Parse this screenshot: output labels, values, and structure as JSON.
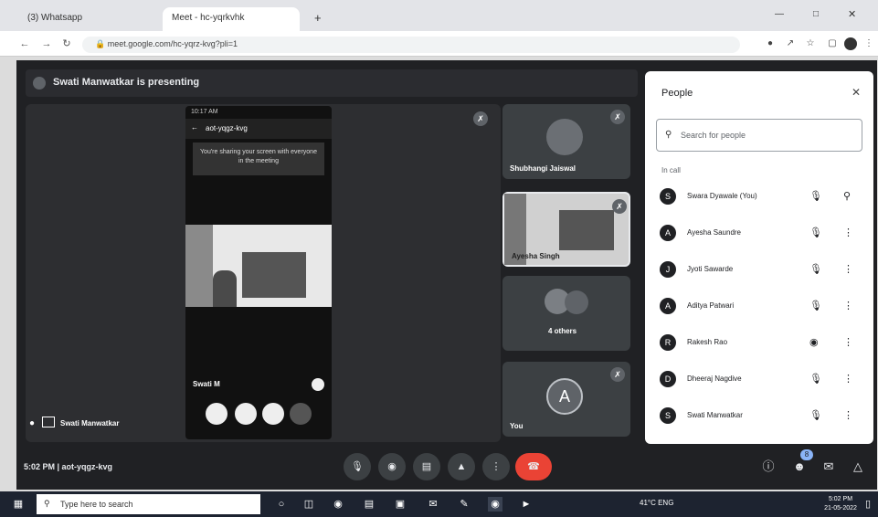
{
  "tabs": [
    {
      "label": "(3) Whatsapp"
    },
    {
      "label": "Meet - hc-yqrkvhk"
    }
  ],
  "browser": {
    "url": "meet.google.com/hc-yqrz-kvg?pli=1",
    "new_tab": "+"
  },
  "meet": {
    "presenting_banner": "Swati Manwatkar is presenting",
    "phone": {
      "status_time": "10:17 AM",
      "header_code": "aot-yqgz-kvg",
      "banner_text": "You're sharing your screen with everyone in the meeting",
      "self_label": "Swati M"
    },
    "presenter_name": "Swati Manwatkar",
    "tiles": [
      {
        "name": "Shubhangi Jaiswal"
      },
      {
        "name": "Ayesha Singh"
      },
      {
        "name": "4 others"
      },
      {
        "name": "You",
        "initial": "A"
      }
    ]
  },
  "people": {
    "title": "People",
    "search_placeholder": "Search for people",
    "section": "In call",
    "participants": [
      {
        "name": "Swara Dyawale (You)",
        "initial": "S"
      },
      {
        "name": "Ayesha Saundre",
        "initial": "A"
      },
      {
        "name": "Jyoti Sawarde",
        "initial": "J"
      },
      {
        "name": "Aditya Patwari",
        "initial": "A"
      },
      {
        "name": "Rakesh Rao",
        "initial": "R"
      },
      {
        "name": "Dheeraj Nagdive",
        "initial": "D"
      },
      {
        "name": "Swati Manwatkar",
        "initial": "S"
      }
    ]
  },
  "bottom": {
    "meeting_info": "5:02 PM  |  aot-yqgz-kvg",
    "participant_count": "8"
  },
  "taskbar": {
    "search_placeholder": "Type here to search",
    "tray_text": "41°C  ENG",
    "clock_time": "5:02 PM",
    "clock_date": "21-05-2022"
  },
  "colors": {
    "meet_bg": "#202124",
    "tile_bg": "#3c4043",
    "end_call": "#ea4335",
    "accent": "#1a73e8"
  }
}
